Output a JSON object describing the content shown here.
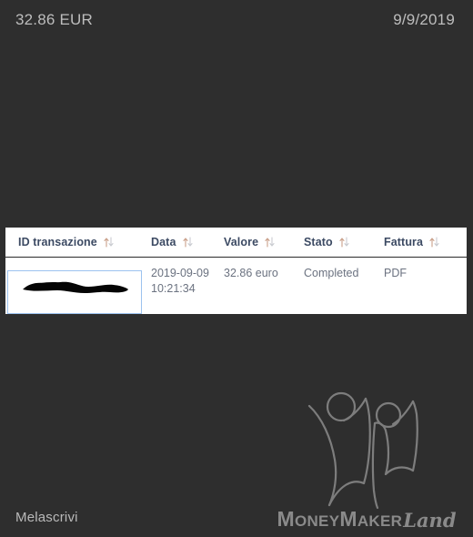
{
  "topbar": {
    "amount": "32.86 EUR",
    "date": "9/9/2019"
  },
  "table": {
    "sort_icon_name": "sort-updown-icon",
    "columns": [
      {
        "label": "ID transazione"
      },
      {
        "label": "Data"
      },
      {
        "label": "Valore"
      },
      {
        "label": "Stato"
      },
      {
        "label": "Fattura"
      }
    ],
    "rows": [
      {
        "id": "",
        "id_redacted": true,
        "data": "2019-09-09 10:21:34",
        "valore": "32.86 euro",
        "stato": "Completed",
        "fattura": "PDF"
      }
    ]
  },
  "footer": {
    "site_label": "Melascrivi",
    "watermark": {
      "word_money_cap": "M",
      "word_money_rest": "ONEY",
      "word_maker_cap": "M",
      "word_maker_rest": "AKER",
      "word_land": "Land",
      "figure_icon_name": "two-people-celebrating-icon"
    }
  },
  "colors": {
    "page_background": "#2e2e2e",
    "panel_background": "#ffffff",
    "header_text": "#3c4a63",
    "body_text": "#6b7280",
    "topbar_text": "#bdbdbd",
    "link_text": "#2d3b55",
    "redaction_border": "#9cc2ef",
    "sort_arrow_up": "#c9a08a",
    "sort_arrow_down": "#c9cbd0",
    "watermark": "#8a8a8a"
  }
}
